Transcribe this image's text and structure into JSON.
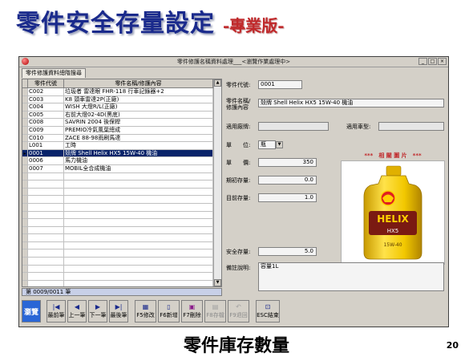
{
  "slide": {
    "title": "零件安全存量設定",
    "subtitle": "-專業版-",
    "caption": "零件庫存數量",
    "page_number": "20"
  },
  "window": {
    "title": "零件修護名稱資料處理___<瀏覽作業處理中>",
    "buttons": [
      "_",
      "□",
      "×"
    ]
  },
  "tab": {
    "label": "零件修護資料總階搜尋"
  },
  "grid": {
    "headers": [
      "零件代號",
      "零件名稱/修護內容"
    ],
    "rows": [
      {
        "code": "C002",
        "name": "垃圾者 雷達眼 FHR-118 行車記錄器+2",
        "selected": false
      },
      {
        "code": "C003",
        "name": "K8 頭車雷達2P(正廠)",
        "selected": false
      },
      {
        "code": "C004",
        "name": "WISH 大燈R/L(正廠)",
        "selected": false
      },
      {
        "code": "C005",
        "name": "右前大燈02-4D(黑底)",
        "selected": false
      },
      {
        "code": "C008",
        "name": "SAVRIN 2004 後保桿",
        "selected": false
      },
      {
        "code": "C009",
        "name": "PREMIO冷氣風葉總成",
        "selected": false
      },
      {
        "code": "C010",
        "name": "ZACE 88-98雨刷馬達",
        "selected": false
      },
      {
        "code": "L001",
        "name": "工時",
        "selected": false
      },
      {
        "code": "0001",
        "name": "殼牌 Shell Helix HX5 15W-40 機油",
        "selected": true
      },
      {
        "code": "0006",
        "name": "馬力機油",
        "selected": false
      },
      {
        "code": "0007",
        "name": "MOBIL全合成機油",
        "selected": false
      },
      {
        "code": "",
        "name": "",
        "selected": false
      },
      {
        "code": "",
        "name": "",
        "selected": false
      },
      {
        "code": "",
        "name": "",
        "selected": false
      },
      {
        "code": "",
        "name": "",
        "selected": false
      },
      {
        "code": "",
        "name": "",
        "selected": false
      },
      {
        "code": "",
        "name": "",
        "selected": false
      },
      {
        "code": "",
        "name": "",
        "selected": false
      },
      {
        "code": "",
        "name": "",
        "selected": false
      },
      {
        "code": "",
        "name": "",
        "selected": false
      },
      {
        "code": "",
        "name": "",
        "selected": false
      },
      {
        "code": "",
        "name": "",
        "selected": false
      },
      {
        "code": "",
        "name": "",
        "selected": false
      },
      {
        "code": "",
        "name": "",
        "selected": false
      },
      {
        "code": "",
        "name": "",
        "selected": false
      },
      {
        "code": "",
        "name": "",
        "selected": false
      }
    ],
    "selected_marker": "▸",
    "counter": "第 0009/0011 筆"
  },
  "detail": {
    "code_label": "零件代號:",
    "code_value": "0001",
    "name_label_1": "零件名稱/",
    "name_label_2": "修護內容",
    "name_value": "殼牌 Shell Helix HX5 15W-40 機油",
    "factory_label": "適用廠牌:",
    "factory_value": "",
    "model_label": "適用車型:",
    "model_value": "",
    "unit_label": "單　　位:",
    "unit_value": "瓶",
    "price_label": "單　　價:",
    "price_value": "350",
    "initial_label": "期初存量:",
    "initial_value": "0.0",
    "current_label": "目前存量:",
    "current_value": "1.0",
    "safety_label": "安全存量:",
    "safety_value": "5.0",
    "note_label": "備註說明:",
    "note_value": "容量1L",
    "photo_caption": "***　相 關 圖 片　***",
    "product_brand": "HELIX",
    "product_grade": "HX5",
    "product_viscosity": "15W-40"
  },
  "toolbar": {
    "browse": "瀏覽",
    "first": "最前筆",
    "prev": "上一筆",
    "next": "下一筆",
    "last": "最後筆",
    "edit": "F5修改",
    "add": "F6新增",
    "delete": "F7刪除",
    "save": "F8存檔",
    "cancel": "F9退回",
    "exit": "ESC結束"
  },
  "colors": {
    "title_blue": "#1a2a8c",
    "subtitle_red": "#c0282a",
    "selection": "#0a246a",
    "shell_yellow": "#f2c800"
  }
}
